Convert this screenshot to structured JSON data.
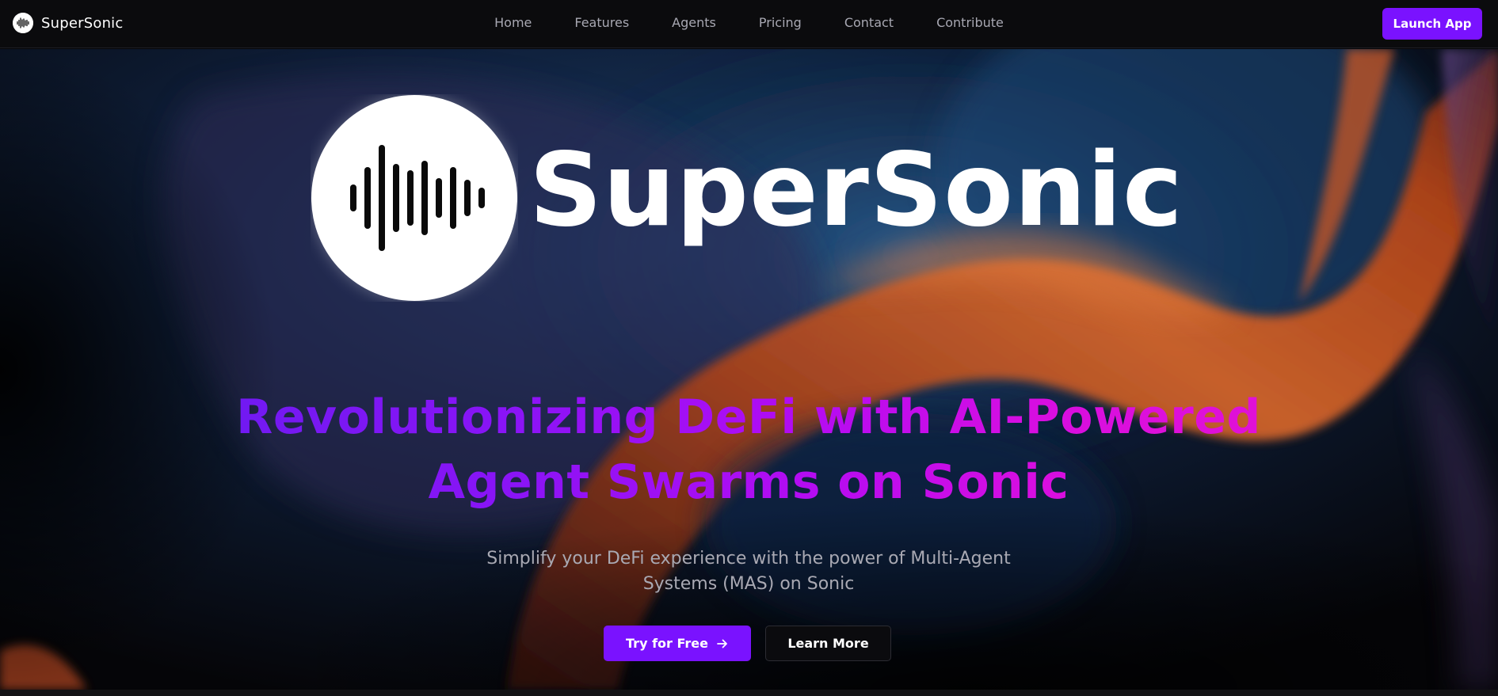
{
  "navbar": {
    "brand_name": "SuperSonic",
    "links": [
      "Home",
      "Features",
      "Agents",
      "Pricing",
      "Contact",
      "Contribute"
    ],
    "launch_label": "Launch App"
  },
  "hero": {
    "logo_icon": "soundwave-icon",
    "wordmark": "SuperSonic",
    "title": "Revolutionizing DeFi with AI-Powered Agent Swarms on Sonic",
    "subtitle": "Simplify your DeFi experience with the power of Multi-Agent Systems (MAS) on Sonic",
    "primary_label": "Try for Free",
    "primary_icon": "arrow-right-icon",
    "secondary_label": "Learn More"
  },
  "colors": {
    "accent": "#7a12ff",
    "title_gradient_start": "#6a1bf0",
    "title_gradient_end": "#e312d3",
    "background": "#050507"
  }
}
